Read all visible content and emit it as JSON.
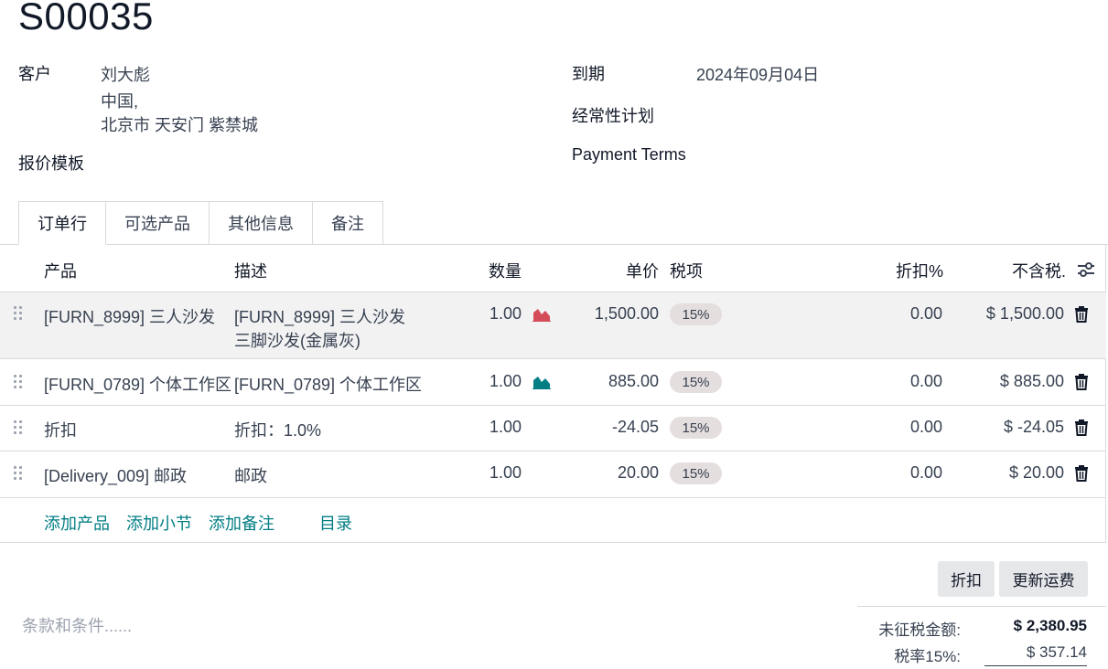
{
  "order": {
    "title": "S00035"
  },
  "customer": {
    "label": "客户",
    "name": "刘大彪",
    "address_line1": "中国,",
    "address_line2": "北京市 天安门 紫禁城"
  },
  "quote_template": {
    "label": "报价模板"
  },
  "due": {
    "label": "到期",
    "value": "2024年09月04日"
  },
  "recurring": {
    "label": "经常性计划"
  },
  "payment_terms": {
    "label": "Payment Terms"
  },
  "tabs": [
    {
      "label": "订单行",
      "active": true
    },
    {
      "label": "可选产品"
    },
    {
      "label": "其他信息"
    },
    {
      "label": "备注"
    }
  ],
  "table": {
    "headers": {
      "product": "产品",
      "description": "描述",
      "quantity": "数量",
      "unit_price": "单价",
      "taxes": "税项",
      "discount": "折扣%",
      "subtotal": "不含税."
    },
    "rows": [
      {
        "product": "[FURN_8999] 三人沙发",
        "description_line1": "[FURN_8999] 三人沙发",
        "description_line2": "三脚沙发(金属灰)",
        "quantity": "1.00",
        "forecast_icon": "area-chart-icon",
        "forecast_color": "#d44c59",
        "unit_price": "1,500.00",
        "tax": "15%",
        "discount": "0.00",
        "subtotal": "$ 1,500.00"
      },
      {
        "product": "[FURN_0789] 个体工作区",
        "description_line1": "[FURN_0789] 个体工作区",
        "quantity": "1.00",
        "forecast_icon": "area-chart-icon",
        "forecast_color": "#017e84",
        "unit_price": "885.00",
        "tax": "15%",
        "discount": "0.00",
        "subtotal": "$ 885.00"
      },
      {
        "product": "折扣",
        "description_line1": "折扣：1.0%",
        "quantity": "1.00",
        "unit_price": "-24.05",
        "tax": "15%",
        "discount": "0.00",
        "subtotal": "$ -24.05"
      },
      {
        "product": "[Delivery_009] 邮政",
        "description_line1": "邮政",
        "quantity": "1.00",
        "unit_price": "20.00",
        "tax": "15%",
        "discount": "0.00",
        "subtotal": "$ 20.00"
      }
    ]
  },
  "actions": {
    "add_product": "添加产品",
    "add_section": "添加小节",
    "add_note": "添加备注",
    "catalog": "目录",
    "discount_button": "折扣",
    "update_shipping_button": "更新运费"
  },
  "terms": {
    "placeholder": "条款和条件......"
  },
  "totals": {
    "untaxed_label": "未征税金额:",
    "untaxed_value": "$ 2,380.95",
    "tax_label": "税率15%:",
    "tax_value": "$ 357.14"
  },
  "colors": {
    "accent": "#017e84",
    "danger": "#d44c59"
  }
}
